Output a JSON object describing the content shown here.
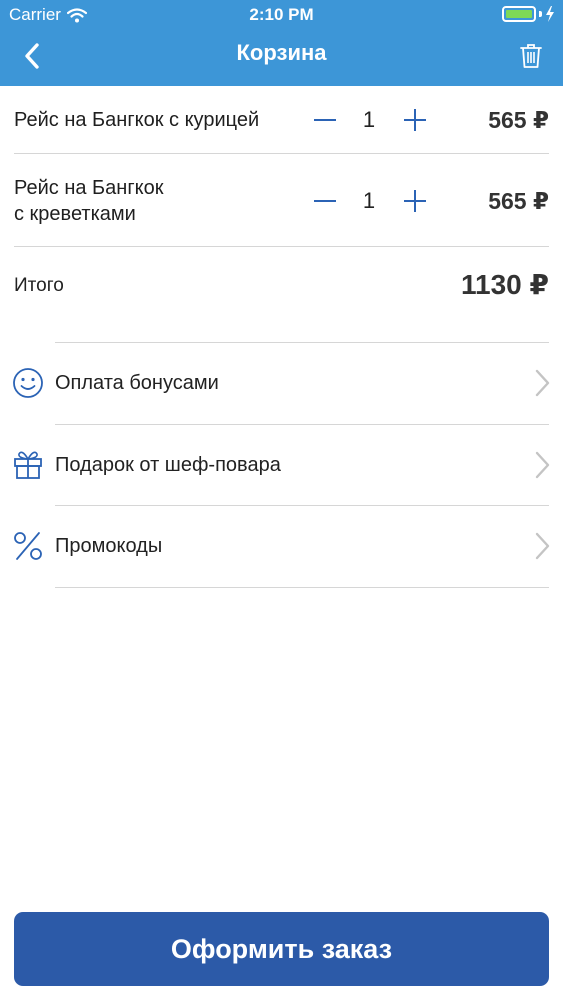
{
  "status_bar": {
    "carrier": "Carrier",
    "time": "2:10 PM",
    "battery_color": "#7ed957"
  },
  "nav": {
    "title": "Корзина",
    "back_icon": "chevron-left-icon",
    "trash_icon": "trash-icon"
  },
  "cart": {
    "items": [
      {
        "name": "Рейс на Бангкок с курицей",
        "quantity": "1",
        "price": "565 ₽"
      },
      {
        "name": "Рейс на Бангкок\nс креветками",
        "quantity": "1",
        "price": "565 ₽"
      }
    ],
    "total_label": "Итого",
    "total_value": "1130 ₽"
  },
  "options": [
    {
      "label": "Оплата бонусами",
      "icon": "smiley-icon"
    },
    {
      "label": "Подарок от шеф-повара",
      "icon": "gift-icon"
    },
    {
      "label": "Промокоды",
      "icon": "percent-icon"
    }
  ],
  "order_button": {
    "label": "Оформить заказ"
  },
  "colors": {
    "header": "#3d96d7",
    "accent": "#2b63b5",
    "button": "#2c5aa8"
  }
}
